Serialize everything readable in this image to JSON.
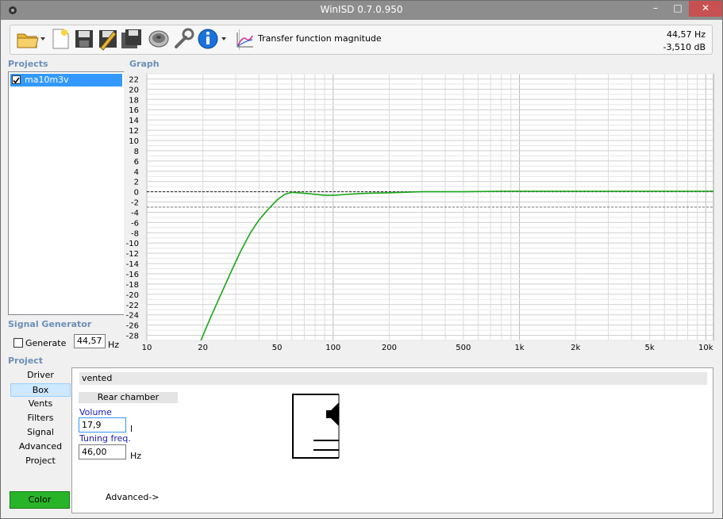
{
  "window": {
    "title": "WinISD 0.7.0.950",
    "min": "–",
    "max": "□",
    "close": "✕"
  },
  "toolbar": {
    "view_label": "Transfer function magnitude",
    "readout_freq": "44,57 Hz",
    "readout_db": "-3,510 dB"
  },
  "projects": {
    "label": "Projects",
    "items": [
      {
        "name": "ma10m3v",
        "checked": true
      }
    ]
  },
  "graph": {
    "label": "Graph",
    "y_ticks": [
      "22",
      "20",
      "18",
      "16",
      "14",
      "12",
      "10",
      "8",
      "6",
      "4",
      "2",
      "0",
      "-2",
      "-4",
      "-6",
      "-8",
      "-10",
      "-12",
      "-14",
      "-16",
      "-18",
      "-20",
      "-22",
      "-24",
      "-26",
      "-28"
    ],
    "x_ticks": [
      "10",
      "20",
      "50",
      "100",
      "200",
      "500",
      "1k",
      "2k",
      "5k",
      "10k"
    ]
  },
  "chart_data": {
    "type": "line",
    "x_scale": "log",
    "xlim": [
      10,
      11000
    ],
    "ylim": [
      -29,
      23
    ],
    "grid": true,
    "reference_lines": [
      0,
      -3
    ],
    "series": [
      {
        "color": "#1aa51a",
        "x": [
          19.5,
          22,
          25,
          28,
          32,
          36,
          40,
          44.57,
          50,
          55,
          60,
          70,
          80,
          90,
          100,
          120,
          150,
          200,
          300,
          500,
          800,
          1000,
          2000,
          5000,
          11000
        ],
        "y": [
          -29,
          -24.5,
          -20,
          -16,
          -11.5,
          -8,
          -5.5,
          -3.51,
          -1.6,
          -0.5,
          -0.1,
          -0.3,
          -0.5,
          -0.7,
          -0.7,
          -0.5,
          -0.3,
          -0.2,
          0,
          0,
          0.1,
          0.1,
          0.1,
          0.1,
          0.1
        ]
      }
    ]
  },
  "signal_generator": {
    "label": "Signal Generator",
    "generate_label": "Generate",
    "frequency": "44,57",
    "unit": "Hz"
  },
  "project_nav": {
    "label": "Project",
    "items": [
      "Driver",
      "Box",
      "Vents",
      "Filters",
      "Signal",
      "Advanced",
      "Project"
    ],
    "selected": "Box",
    "color_button": "Color",
    "color_value": "#28b428"
  },
  "box_panel": {
    "type": "vented",
    "rear_chamber": "Rear chamber",
    "volume_label": "Volume",
    "volume_value": "17,9",
    "volume_unit": "l",
    "tuning_label": "Tuning freq.",
    "tuning_value": "46,00",
    "tuning_unit": "Hz",
    "advanced_link": "Advanced->"
  }
}
